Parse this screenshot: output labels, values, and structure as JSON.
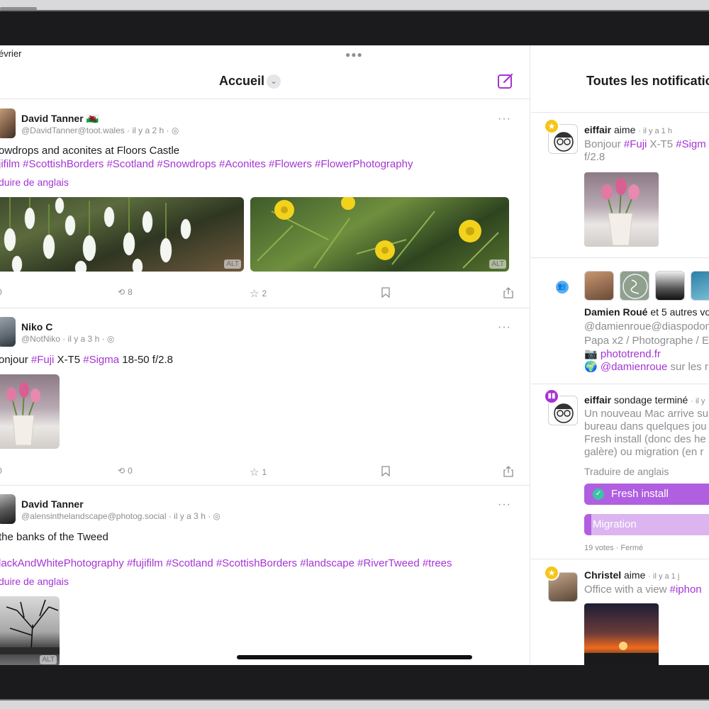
{
  "status": {
    "date": "évrier"
  },
  "timeline": {
    "title": "Accueil",
    "posts": [
      {
        "author": "David Tanner",
        "flag": "🏴󠁧󠁢󠁷󠁬󠁳󠁿",
        "handle": "@DavidTanner@toot.wales",
        "time": "il y a 2 h",
        "text": "owdrops and aconites at Floors Castle",
        "hashtags": "jifilm #ScottishBorders #Scotland #Snowdrops #Aconites #Flowers #FlowerPhotography",
        "translate": "duire de anglais",
        "media": [
          {
            "alt": "ALT"
          },
          {
            "alt": "ALT"
          }
        ],
        "replies": "0",
        "boosts": "8",
        "favorites": "2"
      },
      {
        "author": "Niko C",
        "handle": "@NotNiko",
        "time": "il y a 3 h",
        "text_prefix": "onjour ",
        "tag1": "#Fuji",
        "text_mid": " X-T5 ",
        "tag2": "#Sigma",
        "text_suffix": " 18-50 f/2.8",
        "replies": "0",
        "boosts": "0",
        "favorites": "1"
      },
      {
        "author": "David Tanner",
        "handle": "@alensinthelandscape@photog.social",
        "time": "il y a 3 h",
        "text": "the banks of the Tweed",
        "hashtags": "lackAndWhitePhotography #fujifilm #Scotland #ScottishBorders #landscape #RiverTweed #trees",
        "translate": "duire de anglais",
        "media": [
          {
            "alt": "ALT"
          }
        ]
      }
    ]
  },
  "notifications": {
    "title": "Toutes les notificatio",
    "items": [
      {
        "user": "eiffair",
        "action": "aime",
        "time": "il y a 1 h",
        "body_prefix": "Bonjour ",
        "tag1": "#Fuji",
        "body_mid": " X-T5 ",
        "tag2": "#Sigm",
        "body_line2": "f/2.8"
      },
      {
        "user": "Damien Roué",
        "action": "et 5 autres vo",
        "line1": "@damienroue@diaspodon",
        "line2": "Papa x2 / Photographe / Er",
        "line3_icon": "📷",
        "line3_link": "phototrend.fr",
        "line4_icon": "🌍",
        "line4_link": "@damienroue",
        "line4_rest": " sur les r"
      },
      {
        "user": "eiffair",
        "action": "sondage terminé",
        "time": "il y",
        "body": [
          "Un nouveau Mac arrive su",
          "bureau dans quelques jou",
          "Fresh install (donc des he",
          "galère) ou migration (en r"
        ],
        "translate": "Traduire de anglais",
        "poll": [
          {
            "label": "Fresh install",
            "selected": true,
            "share": 0.95
          },
          {
            "label": "Migration",
            "selected": false,
            "share": 0.05
          }
        ],
        "footer": "19 votes · Fermé"
      },
      {
        "user": "Christel",
        "action": "aime",
        "time": "il y a 1 j",
        "body_prefix": "Office with a view ",
        "tag1": "#iphon"
      }
    ]
  },
  "colors": {
    "accent": "#a534d4",
    "star": "#f5c518",
    "poll_fill": "#b05fe0",
    "poll_empty": "#dcb4f0"
  }
}
